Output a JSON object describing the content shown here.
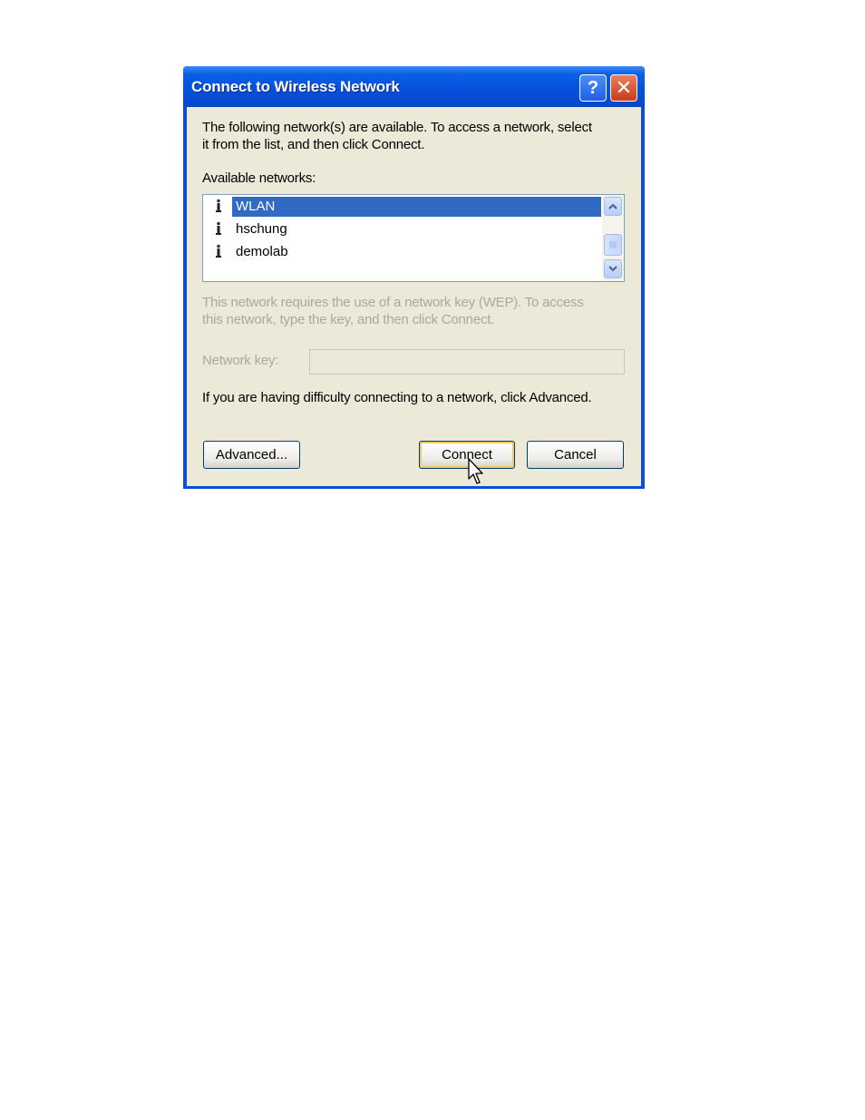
{
  "window": {
    "title": "Connect to Wireless Network",
    "help_glyph": "?",
    "close_glyph": "✕"
  },
  "intro_text_line1": "The following network(s) are available. To access a network, select",
  "intro_text_line2": "it from the list, and then click Connect.",
  "available_label": "Available networks:",
  "networks": [
    {
      "name": "WLAN",
      "selected": true
    },
    {
      "name": "hschung",
      "selected": false
    },
    {
      "name": "demolab",
      "selected": false
    }
  ],
  "wep_text_line1": "This network requires the use of a network key (WEP). To access",
  "wep_text_line2": "this network, type the key, and then click Connect.",
  "network_key": {
    "label": "Network key:",
    "value": ""
  },
  "help_text": "If you are having difficulty connecting to a network, click Advanced.",
  "buttons": {
    "advanced": "Advanced...",
    "connect": "Connect",
    "cancel": "Cancel"
  },
  "colors": {
    "title_blue": "#0550dc",
    "selection": "#316ac5",
    "dialog_face": "#ece9d8",
    "disabled_text": "#aca899"
  }
}
